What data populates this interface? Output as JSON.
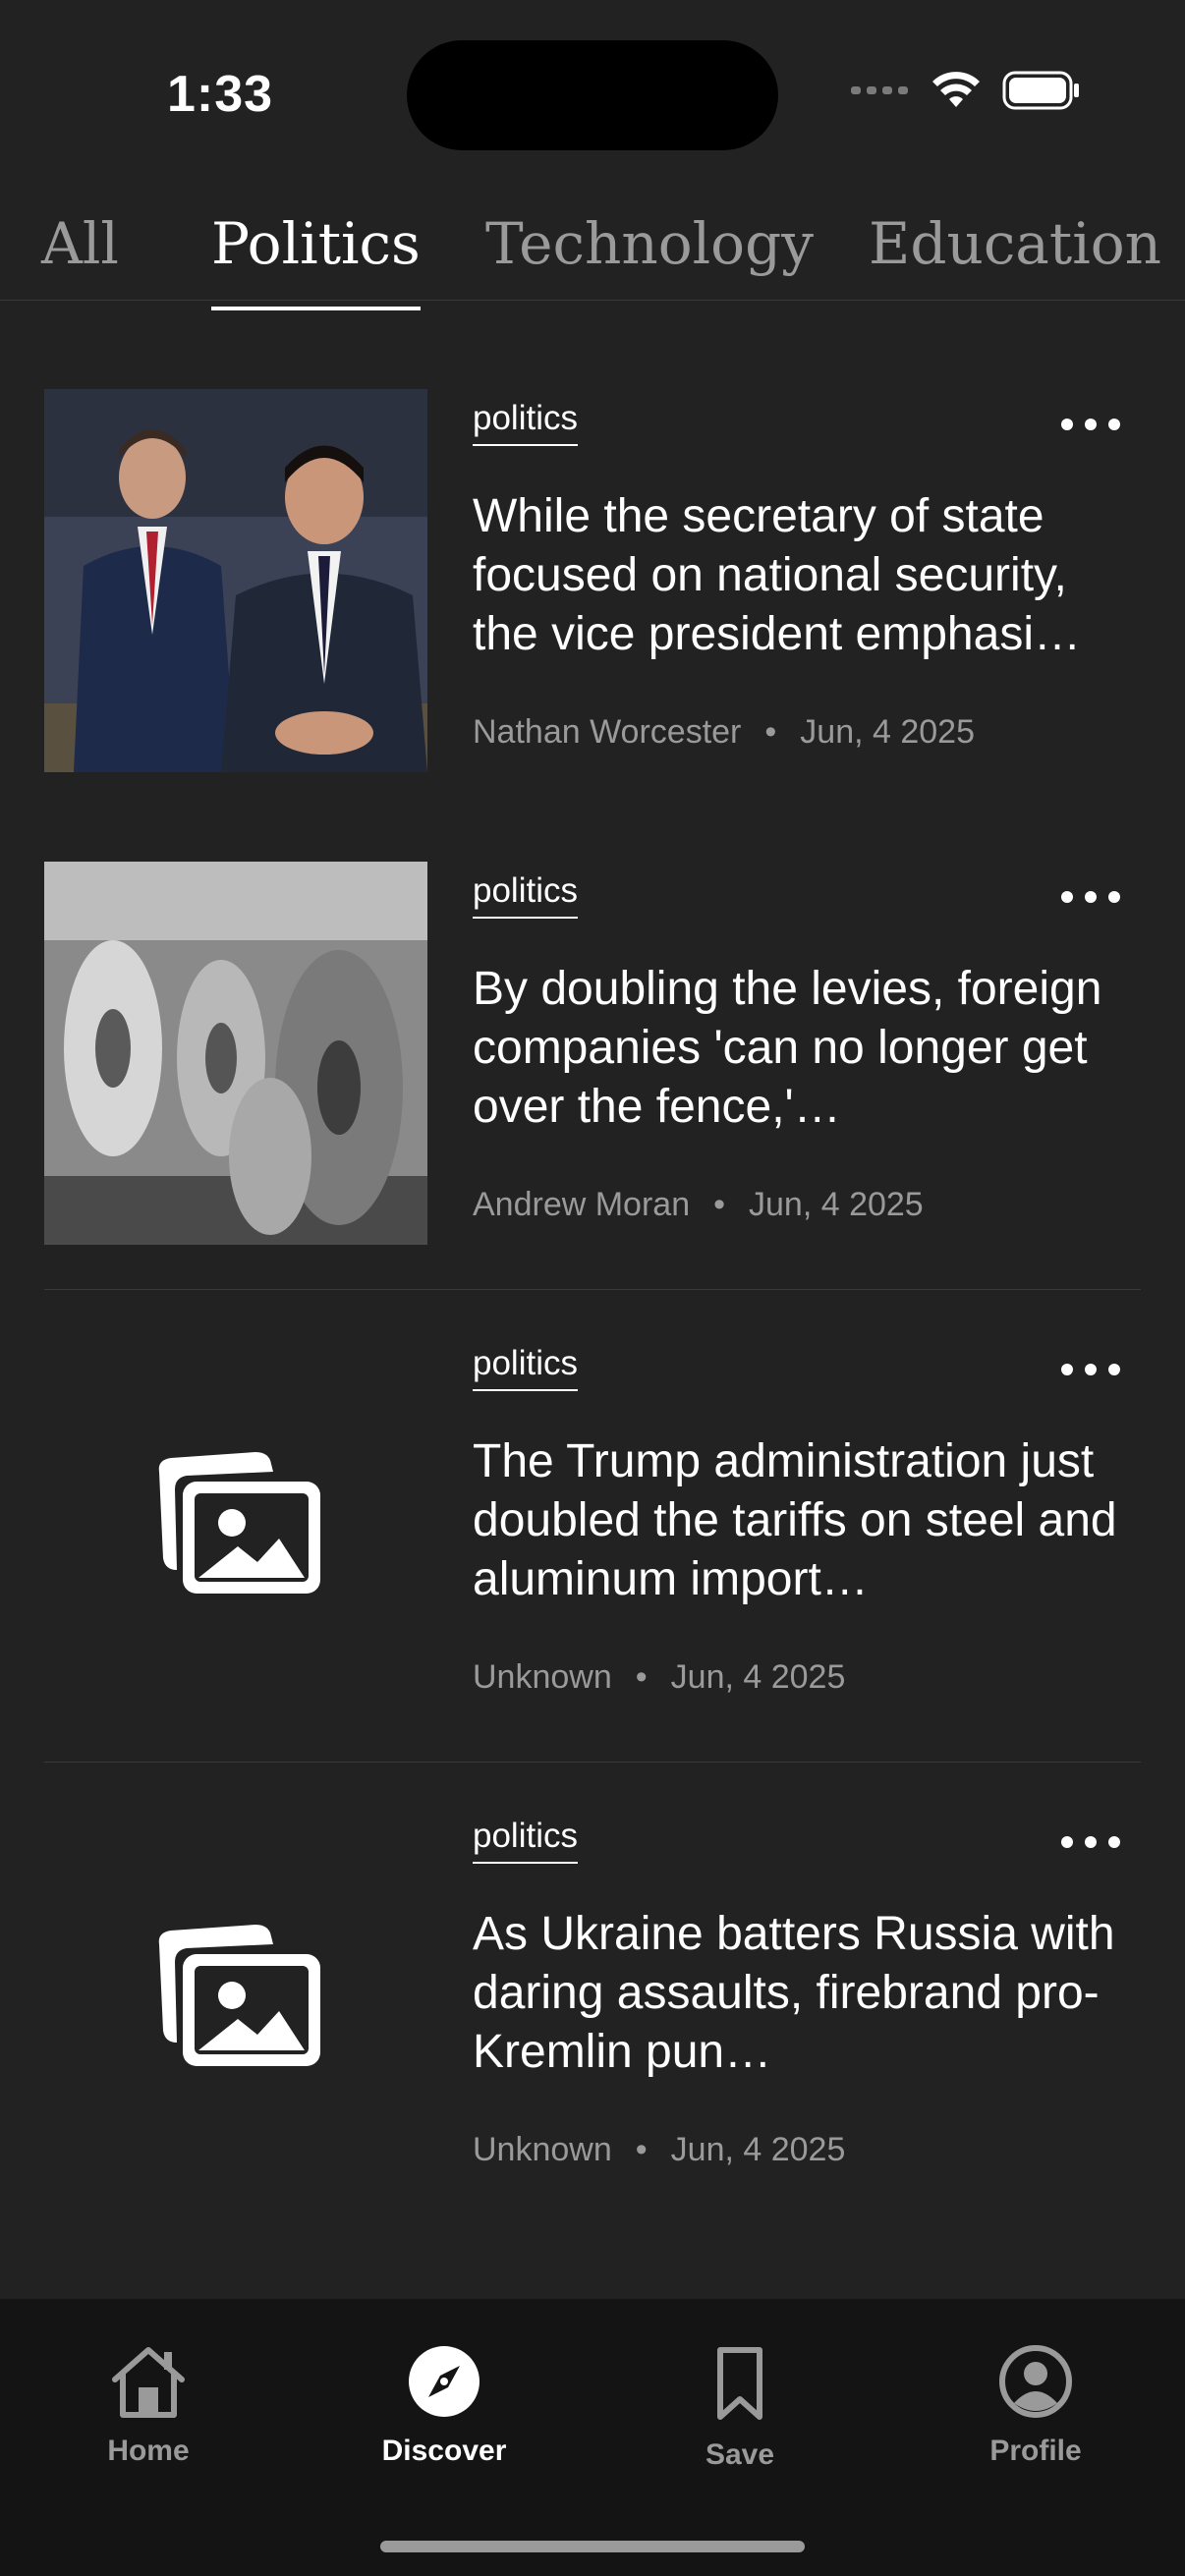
{
  "status_bar": {
    "time": "1:33"
  },
  "tabs": [
    {
      "label": "All"
    },
    {
      "label": "Politics"
    },
    {
      "label": "Technology"
    },
    {
      "label": "Education"
    }
  ],
  "active_tab": "Politics",
  "articles": [
    {
      "category": "politics",
      "title": "While the secretary of state focused on national security, the vice president emphasi…",
      "author": "Nathan Worcester",
      "date": "Jun, 4 2025",
      "image": "photo-two-men-seated"
    },
    {
      "category": "politics",
      "title": "By doubling the levies, foreign companies 'can no longer get over the fence,'…",
      "author": "Andrew Moran",
      "date": "Jun, 4 2025",
      "image": "photo-steel-coils"
    },
    {
      "category": "politics",
      "title": "The Trump administration just doubled the tariffs on steel and aluminum import…",
      "author": "Unknown",
      "date": "Jun, 4 2025",
      "image": "image-placeholder-icon"
    },
    {
      "category": "politics",
      "title": "As Ukraine batters Russia with daring assaults, firebrand pro-Kremlin pun…",
      "author": "Unknown",
      "date": "Jun, 4 2025",
      "image": "image-placeholder-icon"
    }
  ],
  "bottom_nav": {
    "items": [
      {
        "label": "Home",
        "icon": "home-icon"
      },
      {
        "label": "Discover",
        "icon": "compass-icon"
      },
      {
        "label": "Save",
        "icon": "bookmark-icon"
      },
      {
        "label": "Profile",
        "icon": "profile-icon"
      }
    ],
    "active": "Discover"
  },
  "colors": {
    "background": "#222222",
    "nav_background": "#141414",
    "text_primary": "#ffffff",
    "text_secondary": "#9a9a9a"
  }
}
